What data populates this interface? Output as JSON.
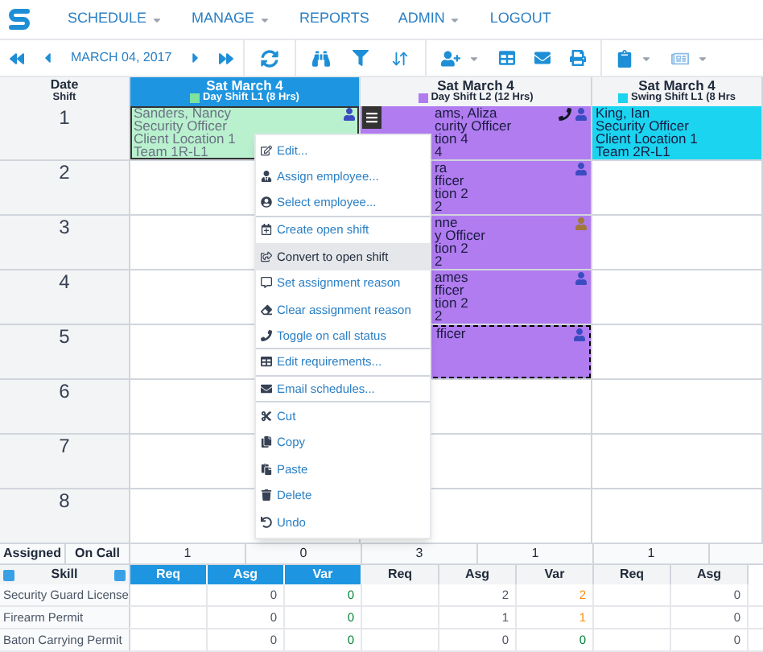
{
  "nav": {
    "items": [
      {
        "label": "SCHEDULE",
        "caret": true
      },
      {
        "label": "MANAGE",
        "caret": true
      },
      {
        "label": "REPORTS",
        "caret": false
      },
      {
        "label": "ADMIN",
        "caret": true
      },
      {
        "label": "LOGOUT",
        "caret": false
      }
    ]
  },
  "toolbar": {
    "date": "MARCH 04, 2017"
  },
  "grid": {
    "corner": {
      "top": "Date",
      "bottom": "Shift"
    },
    "columns": [
      {
        "day": "Sat March 4",
        "shift": "Day Shift L1 (8 Hrs)",
        "color": "#7ee3a0",
        "selected": true
      },
      {
        "day": "Sat March 4",
        "shift": "Day Shift L2 (12 Hrs)",
        "color": "#b07cf0",
        "selected": false
      },
      {
        "day": "Sat March 4",
        "shift": "Swing Shift L1 (8 Hrs",
        "color": "#1ad4f0",
        "selected": false
      }
    ],
    "rows": [
      {
        "label": "1",
        "cells": [
          {
            "kind": "shift",
            "color": "#b9f1cf",
            "dimmed": true,
            "selected": true,
            "dashed": false,
            "on_call": false,
            "employee_icon": {
              "color": "#3b4cc0"
            },
            "lines": [
              "Sanders, Nancy",
              "Security Officer",
              "Client Location 1",
              "Team 1R-L1"
            ]
          },
          {
            "kind": "shift",
            "color": "#b07cf0",
            "dimmed": false,
            "selected": false,
            "dashed": false,
            "on_call": true,
            "employee_icon": {
              "color": "#3b4cc0"
            },
            "lines": [
              "ams, Aliza",
              "curity Officer",
              "tion 4",
              "4"
            ]
          },
          {
            "kind": "shift",
            "color": "#1ad4f0",
            "dimmed": false,
            "selected": false,
            "dashed": false,
            "on_call": false,
            "lines": [
              "King, Ian",
              "Security Officer",
              "Client Location 1",
              "Team 2R-L1"
            ]
          }
        ]
      },
      {
        "label": "2",
        "cells": [
          {
            "kind": "empty"
          },
          {
            "kind": "shift",
            "color": "#b07cf0",
            "dimmed": false,
            "selected": false,
            "dashed": false,
            "on_call": false,
            "employee_icon": {
              "color": "#3b4cc0"
            },
            "lines": [
              "ra",
              "fficer",
              "tion 2",
              "2"
            ]
          },
          {
            "kind": "empty"
          }
        ]
      },
      {
        "label": "3",
        "cells": [
          {
            "kind": "empty"
          },
          {
            "kind": "shift",
            "color": "#b07cf0",
            "dimmed": false,
            "selected": false,
            "dashed": false,
            "on_call": false,
            "employee_icon": {
              "color": "#a0783a"
            },
            "lines": [
              "nne",
              "y Officer",
              "tion 2",
              "2"
            ]
          },
          {
            "kind": "empty"
          }
        ]
      },
      {
        "label": "4",
        "cells": [
          {
            "kind": "empty"
          },
          {
            "kind": "shift",
            "color": "#b07cf0",
            "dimmed": false,
            "selected": false,
            "dashed": false,
            "on_call": false,
            "employee_icon": {
              "color": "#3b4cc0"
            },
            "lines": [
              "ames",
              "fficer",
              "tion 2",
              "2"
            ]
          },
          {
            "kind": "empty"
          }
        ]
      },
      {
        "label": "5",
        "cells": [
          {
            "kind": "empty"
          },
          {
            "kind": "shift",
            "color": "#b07cf0",
            "dimmed": false,
            "selected": false,
            "dashed": true,
            "on_call": false,
            "employee_icon": {
              "color": "#3b4cc0"
            },
            "lines": [
              "fficer"
            ]
          },
          {
            "kind": "empty"
          }
        ]
      },
      {
        "label": "6",
        "cells": [
          {
            "kind": "empty"
          },
          {
            "kind": "empty"
          },
          {
            "kind": "empty"
          }
        ]
      },
      {
        "label": "7",
        "cells": [
          {
            "kind": "empty"
          },
          {
            "kind": "empty"
          },
          {
            "kind": "empty"
          }
        ]
      },
      {
        "label": "8",
        "cells": [
          {
            "kind": "empty"
          },
          {
            "kind": "empty"
          },
          {
            "kind": "empty"
          }
        ]
      }
    ]
  },
  "context_menu": {
    "items": [
      {
        "label": "Edit...",
        "selected": false,
        "divider_after": false
      },
      {
        "label": "Assign employee...",
        "selected": false,
        "divider_after": false
      },
      {
        "label": "Select employee...",
        "selected": false,
        "divider_after": true
      },
      {
        "label": "Create open shift",
        "selected": false,
        "divider_after": false
      },
      {
        "label": "Convert to open shift",
        "selected": true,
        "divider_after": false
      },
      {
        "label": "Set assignment reason",
        "selected": false,
        "divider_after": false
      },
      {
        "label": "Clear assignment reason",
        "selected": false,
        "divider_after": false
      },
      {
        "label": "Toggle on call status",
        "selected": false,
        "divider_after": true
      },
      {
        "label": "Edit requirements...",
        "selected": false,
        "divider_after": true
      },
      {
        "label": "Email schedules...",
        "selected": false,
        "divider_after": true
      },
      {
        "label": "Cut",
        "selected": false,
        "divider_after": false
      },
      {
        "label": "Copy",
        "selected": false,
        "divider_after": false
      },
      {
        "label": "Paste",
        "selected": false,
        "divider_after": false
      },
      {
        "label": "Delete",
        "selected": false,
        "divider_after": false
      },
      {
        "label": "Undo",
        "selected": false,
        "divider_after": false
      }
    ]
  },
  "totals": {
    "assigned_label": "Assigned",
    "on_call_label": "On Call",
    "counts": [
      "1",
      "0",
      "3",
      "1",
      "1"
    ]
  },
  "skills": {
    "title": "Skill",
    "columns": [
      {
        "label": "Req",
        "selected": true
      },
      {
        "label": "Asg",
        "selected": true
      },
      {
        "label": "Var",
        "selected": true
      },
      {
        "label": "Req",
        "selected": false
      },
      {
        "label": "Asg",
        "selected": false
      },
      {
        "label": "Var",
        "selected": false
      },
      {
        "label": "Req",
        "selected": false
      },
      {
        "label": "Asg",
        "selected": false
      }
    ],
    "rows": [
      {
        "name": "Security Guard License",
        "cells": [
          {
            "text": ""
          },
          {
            "text": "0"
          },
          {
            "text": "0",
            "mismatch": false
          },
          {
            "text": ""
          },
          {
            "text": "2"
          },
          {
            "text": "2",
            "mismatch": true
          },
          {
            "text": ""
          },
          {
            "text": "0"
          }
        ]
      },
      {
        "name": "Firearm Permit",
        "cells": [
          {
            "text": ""
          },
          {
            "text": "0"
          },
          {
            "text": "0",
            "mismatch": false
          },
          {
            "text": ""
          },
          {
            "text": "1"
          },
          {
            "text": "1",
            "mismatch": true
          },
          {
            "text": ""
          },
          {
            "text": "0"
          }
        ]
      },
      {
        "name": "Baton Carrying Permit",
        "cells": [
          {
            "text": ""
          },
          {
            "text": "0"
          },
          {
            "text": "0",
            "mismatch": false
          },
          {
            "text": ""
          },
          {
            "text": "0"
          },
          {
            "text": "0",
            "mismatch": false
          },
          {
            "text": ""
          },
          {
            "text": "0"
          }
        ]
      }
    ]
  }
}
